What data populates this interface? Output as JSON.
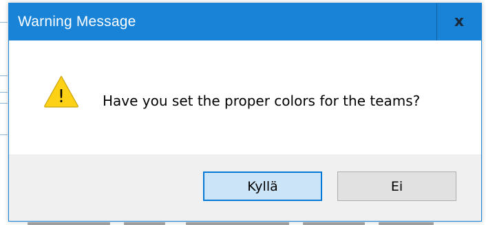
{
  "dialog": {
    "title": "Warning Message",
    "close_label": "x",
    "icon": "warning-icon",
    "icon_glyph": "!",
    "message": "Have you set the proper colors for the teams?",
    "buttons": {
      "yes_label": "Kyllä",
      "no_label": "Ei"
    }
  },
  "colors": {
    "titlebar": "#1883d7",
    "warning_fill": "#fcd116",
    "default_button": "#cce4f7",
    "default_button_border": "#0078d7"
  }
}
